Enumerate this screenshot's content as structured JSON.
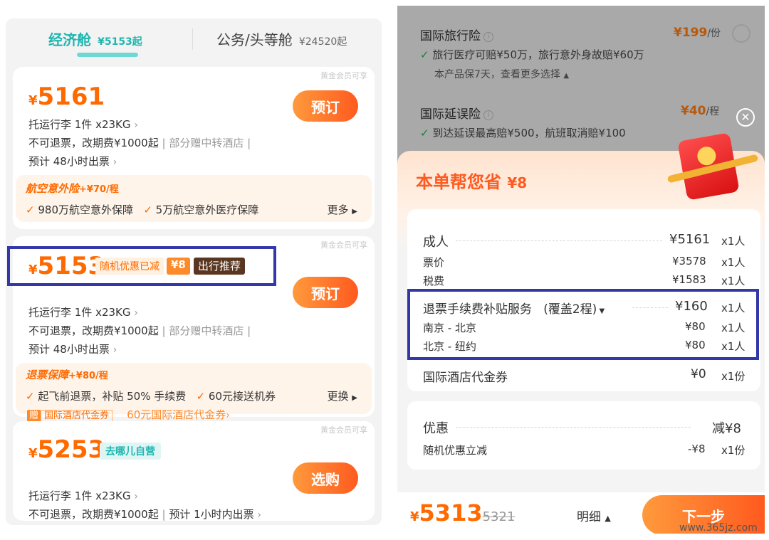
{
  "left": {
    "tabs": {
      "economy": {
        "label": "经济舱",
        "price": "¥5153起"
      },
      "business": {
        "label": "公务/头等舱",
        "price": "¥24520起"
      }
    },
    "cards": [
      {
        "gold_tag": "黄金会员可享",
        "price": "5161",
        "button": "预订",
        "lines": [
          "托运行李 1件 x23KG",
          "不可退票，改期费¥1000起",
          "部分赠中转酒店",
          "预计 48小时出票"
        ],
        "addon": {
          "title": "航空意外险",
          "price": "+¥70/程",
          "items": [
            "980万航空意外保障",
            "5万航空意外医疗保障"
          ],
          "more": "更多"
        }
      },
      {
        "gold_tag": "黄金会员可享",
        "price": "5153",
        "discount_label": "随机优惠已减",
        "discount_amount": "¥8",
        "tag": "出行推荐",
        "button": "预订",
        "lines": [
          "托运行李 1件 x23KG",
          "不可退票，改期费¥1000起",
          "部分赠中转酒店",
          "预计 48小时出票"
        ],
        "addon": {
          "title": "退票保障",
          "price": "+¥80/程",
          "items": [
            "起飞前退票，补贴 50% 手续费",
            "60元接送机券"
          ],
          "more": "更换",
          "gift_badge": "赠",
          "gift_label": "国际酒店代金券",
          "gift_link": "60元国际酒店代金券"
        }
      },
      {
        "gold_tag": "黄金会员可享",
        "price": "5253",
        "tag": "去哪儿自营",
        "button": "选购",
        "lines": [
          "托运行李 1件 x23KG",
          "不可退票，改期费¥1000起",
          "预计 1小时内出票"
        ]
      }
    ]
  },
  "right": {
    "insurance": [
      {
        "name": "国际旅行险",
        "price": "¥199",
        "unit": "/份",
        "desc": "旅行医疗可赔¥50万，旅行意外身故赔¥60万",
        "note": "本产品保7天，查看更多选择"
      },
      {
        "name": "国际延误险",
        "price": "¥40",
        "unit": "/程",
        "desc": "到达延误最高赔¥500，航班取消赔¥100"
      }
    ],
    "savings": {
      "label": "本单帮您省",
      "amount": "¥8"
    },
    "breakdown": [
      {
        "label": "成人",
        "amount": "¥5161",
        "qty": "x1人"
      },
      {
        "label": "票价",
        "amount": "¥3578",
        "qty": "x1人"
      },
      {
        "label": "税费",
        "amount": "¥1583",
        "qty": "x1人"
      },
      {
        "label": "退票手续费补贴服务",
        "extra": "(覆盖2程)",
        "amount": "¥160",
        "qty": "x1人"
      },
      {
        "label": "南京 - 北京",
        "amount": "¥80",
        "qty": "x1人"
      },
      {
        "label": "北京 - 纽约",
        "amount": "¥80",
        "qty": "x1人"
      },
      {
        "label": "国际酒店代金券",
        "amount": "¥0",
        "qty": "x1份"
      }
    ],
    "discount": {
      "label": "优惠",
      "amount": "减¥8",
      "row_label": "随机优惠立减",
      "row_amount": "-¥8",
      "row_qty": "x1份"
    },
    "footer": {
      "total": "5313",
      "original": "5321",
      "detail": "明细",
      "next": "下一步"
    },
    "watermark": "www.365jz.com"
  },
  "colors": {
    "accent": "#ff6a00",
    "highlight_box": "#3337a8",
    "teal": "#1db6b0"
  }
}
